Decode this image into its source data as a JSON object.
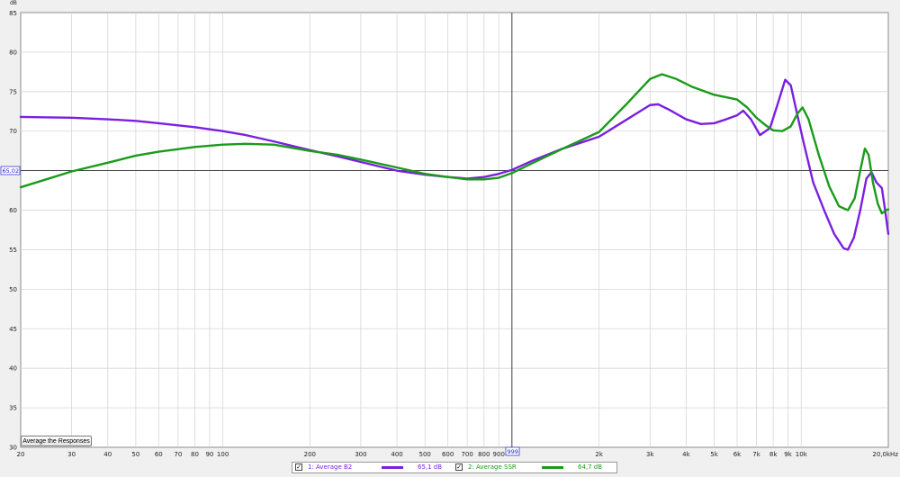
{
  "window": {
    "y_unit_label": "dB",
    "button_label": "Average the Responses"
  },
  "cursor": {
    "level_label": "65,02",
    "freq_label": "999"
  },
  "legend": [
    {
      "check": "✓",
      "name": "1: Average B2",
      "value": "65,1 dB",
      "color": "#7b1fe0"
    },
    {
      "check": "✓",
      "name": "2: Average SSR",
      "value": "64,7 dB",
      "color": "#1b9a1b"
    }
  ],
  "colors": {
    "plot_bg": "#ffffff",
    "grid": "#d6d6d6",
    "cursor": "#444444",
    "series_1": "#7b1fe0",
    "series_2": "#1b9a1b"
  },
  "chart_data": {
    "type": "line",
    "x_scale": "log",
    "xlim": [
      20,
      20000
    ],
    "ylim": [
      30,
      85
    ],
    "xlabel": "",
    "ylabel": "dB",
    "grid": true,
    "x_tick_labels": [
      {
        "v": 20,
        "t": "20"
      },
      {
        "v": 30,
        "t": "30"
      },
      {
        "v": 40,
        "t": "40"
      },
      {
        "v": 50,
        "t": "50"
      },
      {
        "v": 60,
        "t": "60"
      },
      {
        "v": 70,
        "t": "70"
      },
      {
        "v": 80,
        "t": "80"
      },
      {
        "v": 90,
        "t": "90"
      },
      {
        "v": 100,
        "t": "100"
      },
      {
        "v": 200,
        "t": "200"
      },
      {
        "v": 300,
        "t": "300"
      },
      {
        "v": 400,
        "t": "400"
      },
      {
        "v": 500,
        "t": "500"
      },
      {
        "v": 600,
        "t": "600"
      },
      {
        "v": 700,
        "t": "700"
      },
      {
        "v": 800,
        "t": "800"
      },
      {
        "v": 900,
        "t": "900"
      },
      {
        "v": 2000,
        "t": "2k"
      },
      {
        "v": 3000,
        "t": "3k"
      },
      {
        "v": 4000,
        "t": "4k"
      },
      {
        "v": 5000,
        "t": "5k"
      },
      {
        "v": 6000,
        "t": "6k"
      },
      {
        "v": 7000,
        "t": "7k"
      },
      {
        "v": 8000,
        "t": "8k"
      },
      {
        "v": 9000,
        "t": "9k"
      },
      {
        "v": 10000,
        "t": "10k"
      },
      {
        "v": 20000,
        "t": "20,0kHz"
      }
    ],
    "y_tick_labels": [
      {
        "v": 85,
        "t": "85"
      },
      {
        "v": 80,
        "t": "80"
      },
      {
        "v": 75,
        "t": "75"
      },
      {
        "v": 70,
        "t": "70"
      },
      {
        "v": 60,
        "t": "60"
      },
      {
        "v": 55,
        "t": "55"
      },
      {
        "v": 50,
        "t": "50"
      },
      {
        "v": 45,
        "t": "45"
      },
      {
        "v": 40,
        "t": "40"
      },
      {
        "v": 35,
        "t": "35"
      },
      {
        "v": 30,
        "t": "30"
      }
    ],
    "cursor": {
      "x": 999,
      "y": 65.02
    },
    "series": [
      {
        "name": "1: Average B2",
        "color": "#7b1fe0",
        "points": [
          [
            20,
            71.8
          ],
          [
            30,
            71.7
          ],
          [
            40,
            71.5
          ],
          [
            50,
            71.3
          ],
          [
            60,
            71.0
          ],
          [
            80,
            70.5
          ],
          [
            100,
            70.0
          ],
          [
            120,
            69.5
          ],
          [
            150,
            68.7
          ],
          [
            200,
            67.6
          ],
          [
            250,
            66.8
          ],
          [
            300,
            66.1
          ],
          [
            400,
            65.0
          ],
          [
            500,
            64.5
          ],
          [
            600,
            64.2
          ],
          [
            700,
            64.0
          ],
          [
            800,
            64.2
          ],
          [
            900,
            64.6
          ],
          [
            1000,
            65.1
          ],
          [
            1200,
            66.4
          ],
          [
            1500,
            67.8
          ],
          [
            2000,
            69.3
          ],
          [
            2500,
            71.5
          ],
          [
            3000,
            73.3
          ],
          [
            3200,
            73.4
          ],
          [
            3500,
            72.7
          ],
          [
            4000,
            71.5
          ],
          [
            4500,
            70.9
          ],
          [
            5000,
            71.0
          ],
          [
            5500,
            71.5
          ],
          [
            6000,
            72.0
          ],
          [
            6300,
            72.6
          ],
          [
            6700,
            71.5
          ],
          [
            7200,
            69.5
          ],
          [
            7800,
            70.4
          ],
          [
            8300,
            73.5
          ],
          [
            8800,
            76.5
          ],
          [
            9200,
            75.8
          ],
          [
            9700,
            72.0
          ],
          [
            10200,
            68.5
          ],
          [
            11000,
            63.5
          ],
          [
            12000,
            60.0
          ],
          [
            13000,
            57.0
          ],
          [
            14000,
            55.2
          ],
          [
            14500,
            55.0
          ],
          [
            15200,
            56.5
          ],
          [
            16000,
            60.0
          ],
          [
            16800,
            64.0
          ],
          [
            17500,
            64.8
          ],
          [
            18200,
            63.5
          ],
          [
            19000,
            62.8
          ],
          [
            19500,
            60.0
          ],
          [
            20000,
            57.0
          ]
        ]
      },
      {
        "name": "2: Average SSR",
        "color": "#1b9a1b",
        "points": [
          [
            20,
            62.9
          ],
          [
            25,
            64.0
          ],
          [
            30,
            64.9
          ],
          [
            40,
            66.0
          ],
          [
            50,
            66.9
          ],
          [
            60,
            67.4
          ],
          [
            80,
            68.0
          ],
          [
            100,
            68.3
          ],
          [
            120,
            68.4
          ],
          [
            150,
            68.3
          ],
          [
            200,
            67.5
          ],
          [
            250,
            67.0
          ],
          [
            300,
            66.4
          ],
          [
            400,
            65.4
          ],
          [
            500,
            64.6
          ],
          [
            600,
            64.2
          ],
          [
            700,
            63.9
          ],
          [
            800,
            63.9
          ],
          [
            900,
            64.1
          ],
          [
            1000,
            64.7
          ],
          [
            1200,
            66.1
          ],
          [
            1500,
            67.8
          ],
          [
            2000,
            69.9
          ],
          [
            2500,
            73.5
          ],
          [
            3000,
            76.6
          ],
          [
            3300,
            77.2
          ],
          [
            3700,
            76.6
          ],
          [
            4200,
            75.6
          ],
          [
            5000,
            74.6
          ],
          [
            6000,
            74.0
          ],
          [
            6500,
            73.0
          ],
          [
            7000,
            71.7
          ],
          [
            7500,
            70.8
          ],
          [
            8000,
            70.1
          ],
          [
            8600,
            70.0
          ],
          [
            9200,
            70.6
          ],
          [
            9700,
            72.2
          ],
          [
            10100,
            73.0
          ],
          [
            10600,
            71.5
          ],
          [
            11500,
            67.0
          ],
          [
            12500,
            63.0
          ],
          [
            13500,
            60.5
          ],
          [
            14500,
            60.0
          ],
          [
            15300,
            61.5
          ],
          [
            16000,
            65.0
          ],
          [
            16600,
            67.8
          ],
          [
            17100,
            67.0
          ],
          [
            17700,
            63.5
          ],
          [
            18400,
            60.8
          ],
          [
            19000,
            59.6
          ],
          [
            19700,
            60.0
          ],
          [
            20000,
            60.1
          ]
        ]
      }
    ]
  }
}
